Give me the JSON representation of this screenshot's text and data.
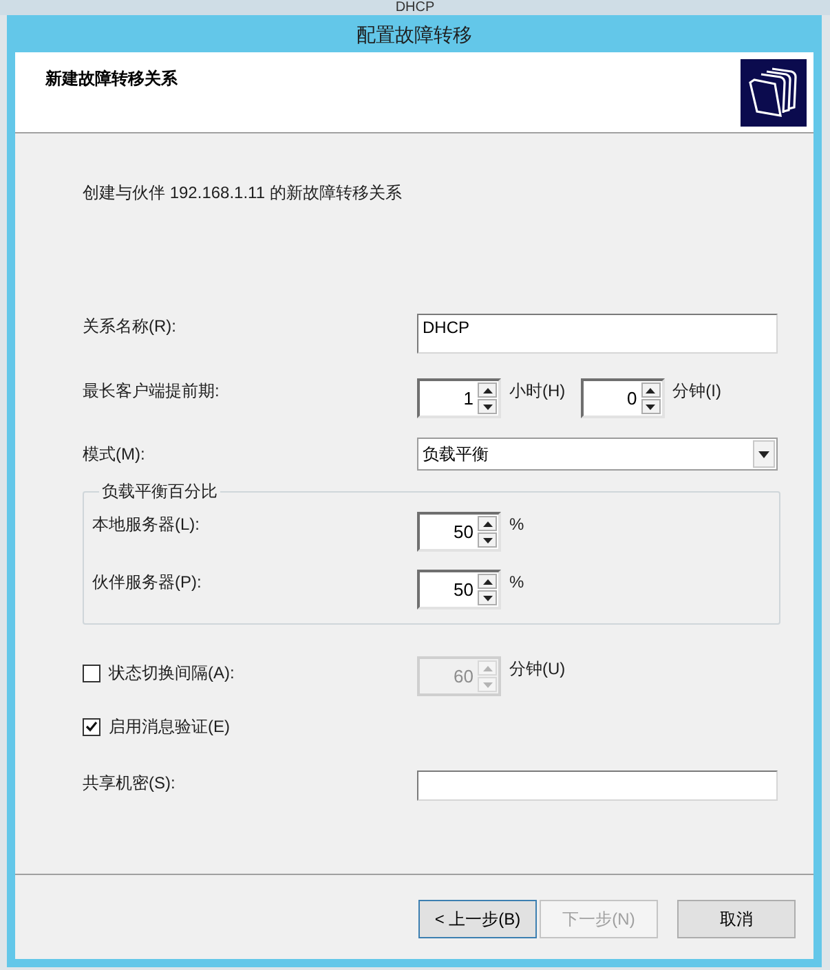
{
  "background_window": {
    "title": "DHCP"
  },
  "window": {
    "title": "配置故障转移"
  },
  "header": {
    "title": "新建故障转移关系"
  },
  "description": "创建与伙伴 192.168.1.11 的新故障转移关系",
  "rows": [
    {
      "kind": "text",
      "label": "关系名称(R):",
      "value": "DHCP"
    },
    {
      "kind": "spinners",
      "label": "最长客户端提前期:",
      "spinners": [
        {
          "value": "1",
          "unit": "小时(H)",
          "disabled": false
        },
        {
          "value": "0",
          "unit": "分钟(I)",
          "disabled": false
        }
      ]
    },
    {
      "kind": "select",
      "label": "模式(M):",
      "value": "负载平衡"
    },
    {
      "kind": "group",
      "title": "负载平衡百分比",
      "rows": [
        {
          "label": "本地服务器(L):",
          "spinner": {
            "value": "50",
            "unit": "%",
            "disabled": false
          }
        },
        {
          "label": "伙伴服务器(P):",
          "spinner": {
            "value": "50",
            "unit": "%",
            "disabled": false
          }
        }
      ]
    },
    {
      "kind": "checkbox",
      "label": "状态切换间隔(A):",
      "checked": false,
      "spinner": {
        "value": "60",
        "unit": "分钟(U)",
        "disabled": true
      }
    },
    {
      "kind": "checkbox",
      "label": "启用消息验证(E)",
      "checked": true
    },
    {
      "kind": "text",
      "label": "共享机密(S):"
    }
  ],
  "buttons": [
    {
      "label": "< 上一步(B)",
      "default": true,
      "disabled": false
    },
    {
      "label": "下一步(N)",
      "default": false,
      "disabled": true
    },
    {
      "label": "取消",
      "default": false,
      "disabled": false
    }
  ]
}
